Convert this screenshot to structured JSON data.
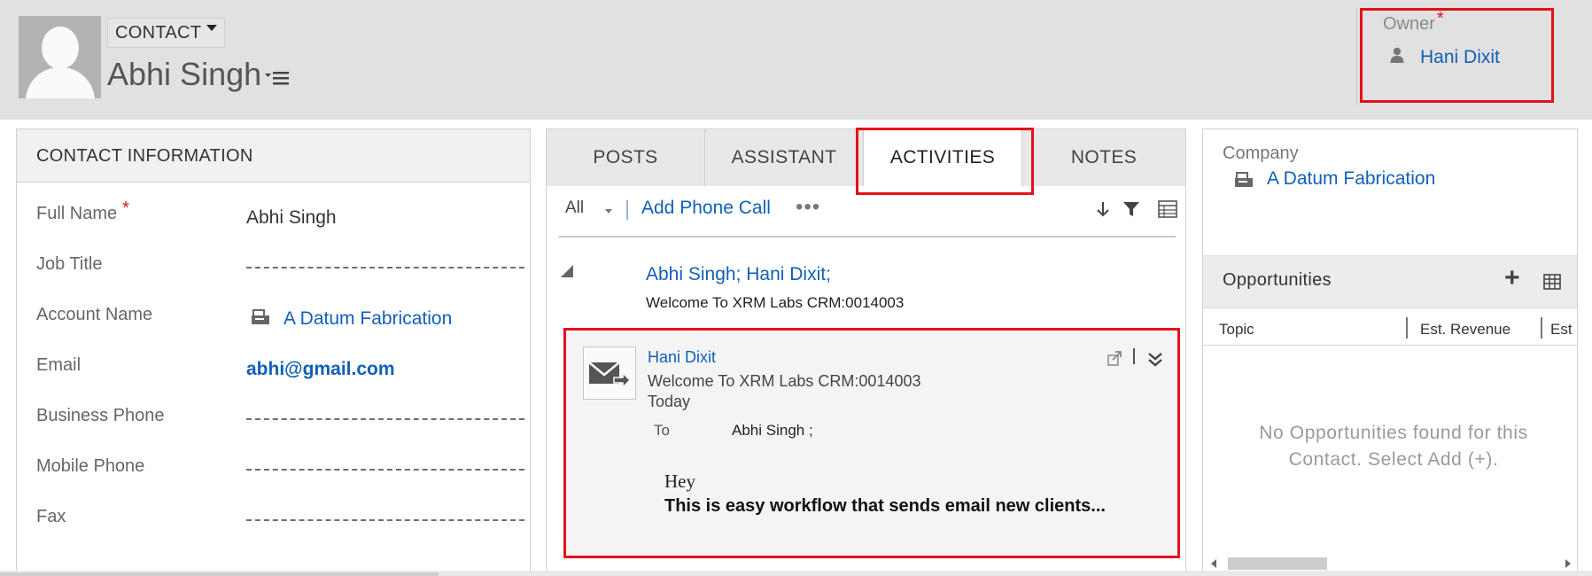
{
  "header": {
    "entity_label": "CONTACT",
    "record_name": "Abhi Singh",
    "owner": {
      "label": "Owner",
      "required_marker": "*",
      "value": "Hani Dixit"
    }
  },
  "contact_info": {
    "title": "CONTACT INFORMATION",
    "fields": [
      {
        "label": "Full Name",
        "required": "*",
        "value": "Abhi Singh"
      },
      {
        "label": "Job Title",
        "value": ""
      },
      {
        "label": "Account Name",
        "value": "A Datum Fabrication"
      },
      {
        "label": "Email",
        "value": "abhi@gmail.com"
      },
      {
        "label": "Business Phone",
        "value": ""
      },
      {
        "label": "Mobile Phone",
        "value": ""
      },
      {
        "label": "Fax",
        "value": ""
      }
    ]
  },
  "tabs": [
    {
      "label": "POSTS"
    },
    {
      "label": "ASSISTANT"
    },
    {
      "label": "ACTIVITIES",
      "active": true
    },
    {
      "label": "NOTES"
    }
  ],
  "activities": {
    "filter": "All",
    "add_action": "Add Phone Call",
    "more": "•••",
    "thread_header": {
      "participants": "Abhi Singh; Hani Dixit;",
      "subject": "Welcome To XRM Labs CRM:0014003"
    },
    "email": {
      "sender": "Hani Dixit",
      "subject": "Welcome To XRM Labs CRM:0014003",
      "date": "Today",
      "to_label": "To",
      "to_value": "Abhi Singh ;",
      "greeting": "Hey",
      "body": "This is easy workflow that sends email new clients..."
    }
  },
  "right_panel": {
    "company_label": "Company",
    "company_value": "A Datum Fabrication",
    "opportunities": {
      "title": "Opportunities",
      "add_symbol": "+",
      "columns": [
        "Topic",
        "Est. Revenue",
        "Est"
      ],
      "empty_message": "No Opportunities found for this Contact. Select Add (+)."
    }
  },
  "colors": {
    "link": "#1160b7",
    "highlight_border": "#e3111b",
    "header_bg": "#e1e1e1"
  }
}
